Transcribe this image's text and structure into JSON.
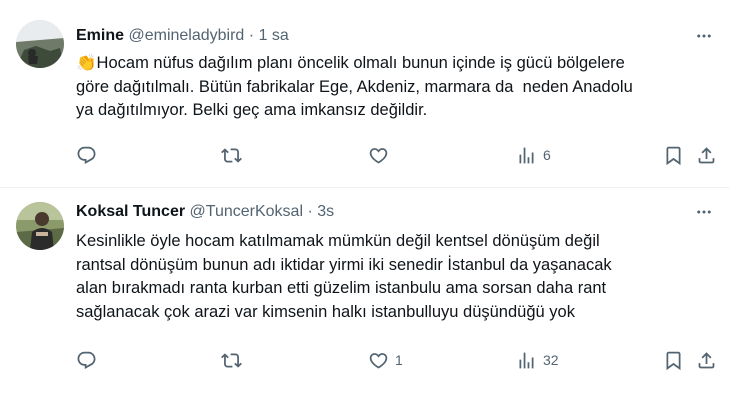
{
  "tweets": [
    {
      "display_name": "Emine",
      "handle": "@emineladybird",
      "separator": "·",
      "time": "1 sa",
      "emoji": "👏",
      "text": "Hocam nüfus dağılım planı öncelik olmalı bunun içinde iş gücü bölgelere\ngöre dağıtılmalı. Bütün fabrikalar Ege, Akdeniz, marmara da  neden Anadolu\nya dağıtılmıyor. Belki geç ama imkansız değildir.",
      "stats": {
        "replies": "",
        "retweets": "",
        "likes": "",
        "views": "6"
      }
    },
    {
      "display_name": "Koksal Tuncer",
      "handle": "@TuncerKoksal",
      "separator": "·",
      "time": "3s",
      "emoji": "",
      "text": "Kesinlikle öyle hocam katılmamak mümkün değil kentsel dönüşüm değil\nrantsal dönüşüm bunun adı iktidar yirmi iki senedir İstanbul da yaşanacak\nalan bırakmadı ranta kurban etti güzelim istanbulu ama sorsan daha rant\nsağlanacak çok arazi var kimsenin halkı istanbulluyu düşündüğü yok",
      "stats": {
        "replies": "",
        "retweets": "",
        "likes": "1",
        "views": "32"
      }
    }
  ],
  "icons": {
    "more": "more-horizontal-icon",
    "reply": "reply-icon",
    "retweet": "retweet-icon",
    "like": "heart-icon",
    "views": "views-chart-icon",
    "bookmark": "bookmark-icon",
    "share": "share-icon"
  },
  "colors": {
    "name": "#0f1419",
    "meta": "#536471",
    "divider": "#eff3f4"
  }
}
